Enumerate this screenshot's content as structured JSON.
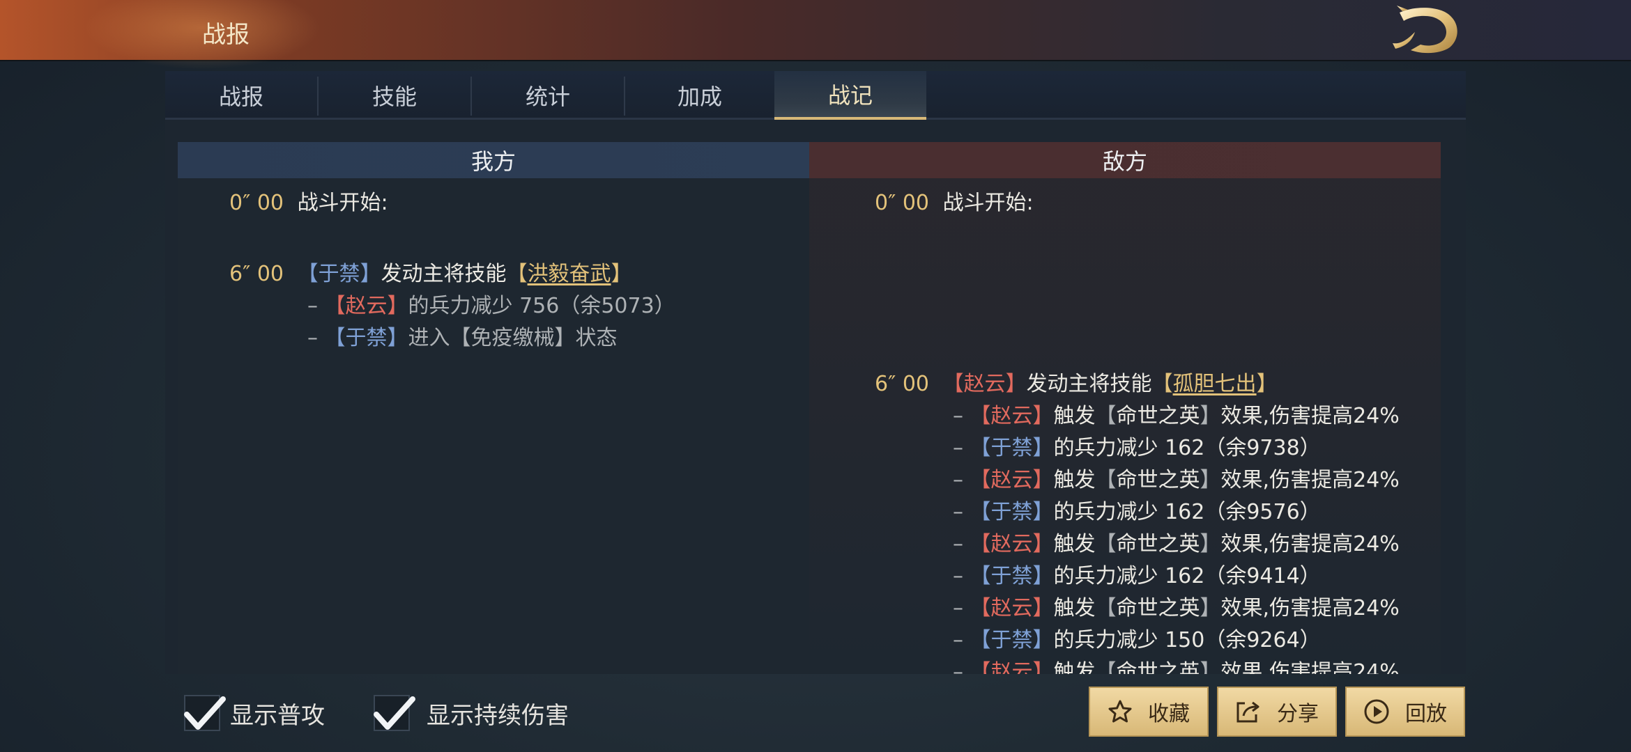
{
  "header": {
    "title": "战报"
  },
  "tabs": [
    {
      "label": "战报",
      "active": false
    },
    {
      "label": "技能",
      "active": false
    },
    {
      "label": "统计",
      "active": false
    },
    {
      "label": "加成",
      "active": false
    },
    {
      "label": "战记",
      "active": true
    }
  ],
  "sides": {
    "ours": "我方",
    "enemy": "敌方"
  },
  "ours_log": {
    "start_time": "0″ 00",
    "start_text": "战斗开始:",
    "e1_time": "6″ 00",
    "e1_actor": "于禁",
    "e1_action": "发动主将技能",
    "e1_skill": "洪毅奋武",
    "e1_l1_target": "赵云",
    "e1_l1_text": "的兵力减少 756（余5073）",
    "e1_l2_target": "于禁",
    "e1_l2_text_a": "进入",
    "e1_l2_status": "免疫缴械",
    "e1_l2_text_b": "状态"
  },
  "enemy_log": {
    "start_time": "0″ 00",
    "start_text": "战斗开始:",
    "e1_time": "6″ 00",
    "e1_actor": "赵云",
    "e1_action": "发动主将技能",
    "e1_skill": "孤胆七出",
    "trigger_text_a": "触发",
    "trigger_effect": "命世之英",
    "trigger_text_b": "效果,伤害提高24%",
    "lines": [
      {
        "who": "赵云",
        "side": "red",
        "kind": "trigger"
      },
      {
        "who": "于禁",
        "side": "blue",
        "kind": "damage",
        "text": "的兵力减少 162（余9738）"
      },
      {
        "who": "赵云",
        "side": "red",
        "kind": "trigger"
      },
      {
        "who": "于禁",
        "side": "blue",
        "kind": "damage",
        "text": "的兵力减少 162（余9576）"
      },
      {
        "who": "赵云",
        "side": "red",
        "kind": "trigger"
      },
      {
        "who": "于禁",
        "side": "blue",
        "kind": "damage",
        "text": "的兵力减少 162（余9414）"
      },
      {
        "who": "赵云",
        "side": "red",
        "kind": "trigger"
      },
      {
        "who": "于禁",
        "side": "blue",
        "kind": "damage",
        "text": "的兵力减少 150（余9264）"
      },
      {
        "who": "赵云",
        "side": "red",
        "kind": "trigger"
      }
    ]
  },
  "footer": {
    "show_normal_attack": {
      "label": "显示普攻",
      "checked": true
    },
    "show_dot": {
      "label": "显示持续伤害",
      "checked": true
    },
    "favorite_label": "收藏",
    "share_label": "分享",
    "replay_label": "回放"
  },
  "colors": {
    "gold": "#e3c27a",
    "ally_blue": "#7fa1d6",
    "enemy_red": "#e26a5e",
    "button_gold": "#e6c98c"
  },
  "icons": {
    "logo": "dragon-logo-icon",
    "favorite": "star-icon",
    "share": "share-icon",
    "replay": "play-circle-icon",
    "checkbox": "checkmark-icon"
  }
}
